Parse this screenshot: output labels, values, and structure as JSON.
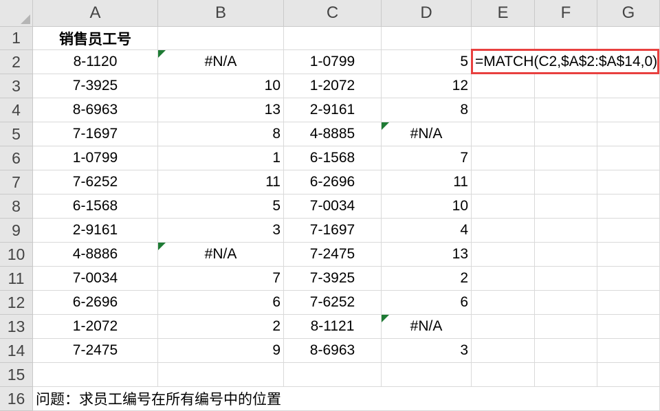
{
  "columns": [
    "A",
    "B",
    "C",
    "D",
    "E",
    "F",
    "G"
  ],
  "rows": [
    "1",
    "2",
    "3",
    "4",
    "5",
    "6",
    "7",
    "8",
    "9",
    "10",
    "11",
    "12",
    "13",
    "14",
    "15",
    "16"
  ],
  "header_a1": "销售员工号",
  "col_a": [
    "8-1120",
    "7-3925",
    "8-6963",
    "7-1697",
    "1-0799",
    "7-6252",
    "6-1568",
    "2-9161",
    "4-8886",
    "7-0034",
    "6-2696",
    "1-2072",
    "7-2475"
  ],
  "col_b": [
    "#N/A",
    "10",
    "13",
    "8",
    "1",
    "11",
    "5",
    "3",
    "#N/A",
    "7",
    "6",
    "2",
    "9"
  ],
  "col_c": [
    "1-0799",
    "1-2072",
    "2-9161",
    "4-8885",
    "6-1568",
    "6-2696",
    "7-0034",
    "7-1697",
    "7-2475",
    "7-3925",
    "7-6252",
    "8-1121",
    "8-6963"
  ],
  "col_d": [
    "5",
    "12",
    "8",
    "#N/A",
    "7",
    "11",
    "10",
    "4",
    "13",
    "2",
    "6",
    "#N/A",
    "3"
  ],
  "formula": "=MATCH(C2,$A$2:$A$14,0)",
  "question": "问题：求员工编号在所有编号中的位置",
  "colors": {
    "highlight_border": "#e8403f",
    "error_indicator": "#1e7b34",
    "header_bg": "#e6e6e6"
  }
}
